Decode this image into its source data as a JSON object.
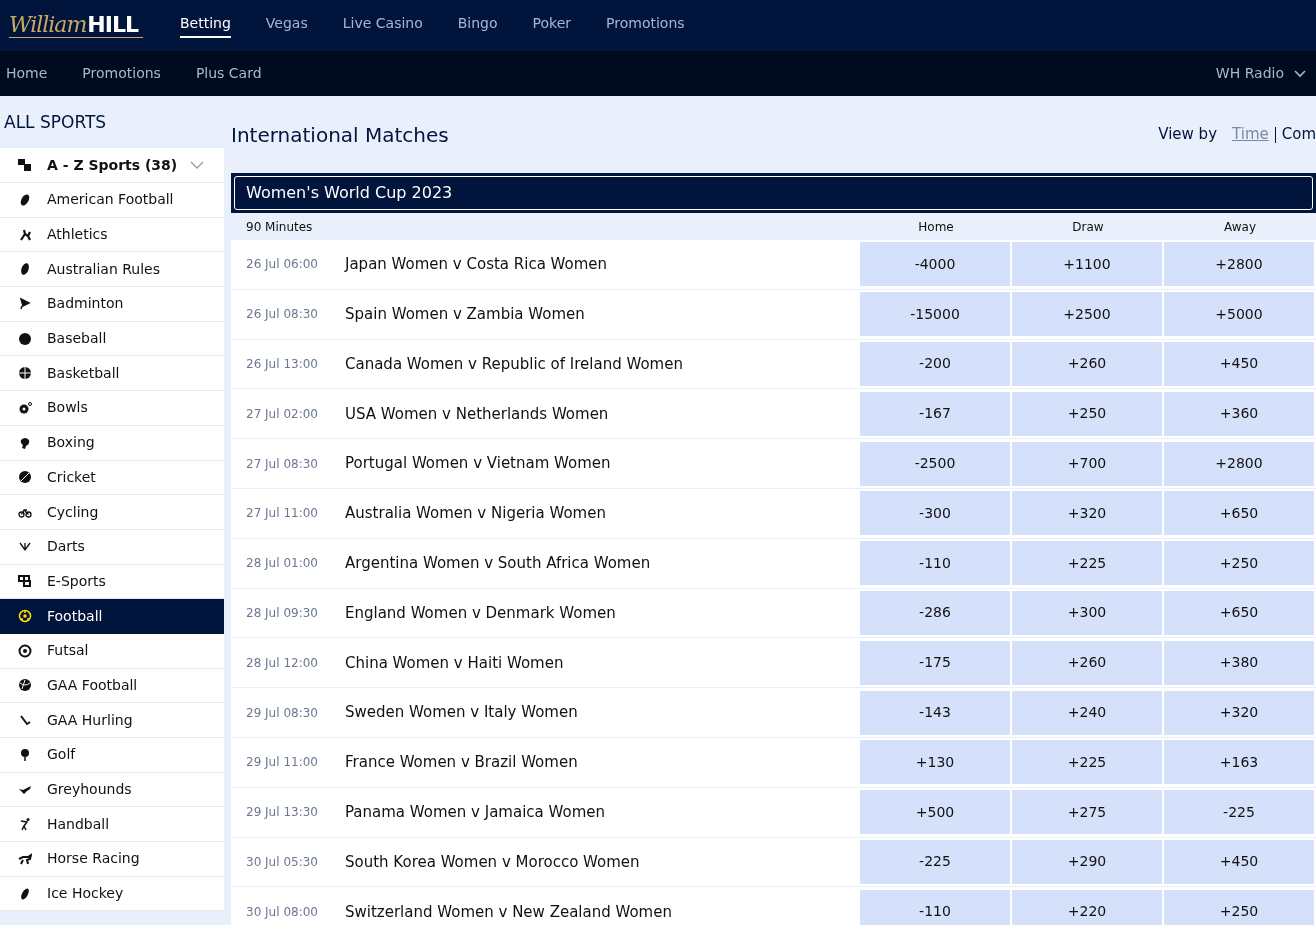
{
  "logo": {
    "script": "William",
    "bold": "HILL"
  },
  "top_nav": [
    {
      "label": "Betting",
      "selected": true
    },
    {
      "label": "Vegas",
      "selected": false
    },
    {
      "label": "Live Casino",
      "selected": false
    },
    {
      "label": "Bingo",
      "selected": false
    },
    {
      "label": "Poker",
      "selected": false
    },
    {
      "label": "Promotions",
      "selected": false
    }
  ],
  "sub_nav": [
    "Home",
    "Promotions",
    "Plus Card"
  ],
  "radio": {
    "label": "WH Radio"
  },
  "sidebar": {
    "title": "ALL SPORTS",
    "az": {
      "label": "A - Z Sports (38)"
    },
    "items": [
      {
        "label": "American Football",
        "selected": false
      },
      {
        "label": "Athletics",
        "selected": false
      },
      {
        "label": "Australian Rules",
        "selected": false
      },
      {
        "label": "Badminton",
        "selected": false
      },
      {
        "label": "Baseball",
        "selected": false
      },
      {
        "label": "Basketball",
        "selected": false
      },
      {
        "label": "Bowls",
        "selected": false
      },
      {
        "label": "Boxing",
        "selected": false
      },
      {
        "label": "Cricket",
        "selected": false
      },
      {
        "label": "Cycling",
        "selected": false
      },
      {
        "label": "Darts",
        "selected": false
      },
      {
        "label": "E-Sports",
        "selected": false
      },
      {
        "label": "Football",
        "selected": true
      },
      {
        "label": "Futsal",
        "selected": false
      },
      {
        "label": "GAA Football",
        "selected": false
      },
      {
        "label": "GAA Hurling",
        "selected": false
      },
      {
        "label": "Golf",
        "selected": false
      },
      {
        "label": "Greyhounds",
        "selected": false
      },
      {
        "label": "Handball",
        "selected": false
      },
      {
        "label": "Horse Racing",
        "selected": false
      },
      {
        "label": "Ice Hockey",
        "selected": false
      }
    ]
  },
  "page_title": "International Matches",
  "view_by": {
    "label": "View by",
    "options": [
      {
        "label": "Time",
        "selected": false
      },
      {
        "label": "Com",
        "selected": true
      }
    ]
  },
  "competition": {
    "title": "Women's World Cup 2023",
    "market": "90 Minutes",
    "columns": [
      "Home",
      "Draw",
      "Away"
    ],
    "matches": [
      {
        "time": "26 Jul 06:00",
        "name": "Japan Women v Costa Rica Women",
        "odds": [
          "-4000",
          "+1100",
          "+2800"
        ]
      },
      {
        "time": "26 Jul 08:30",
        "name": "Spain Women v Zambia Women",
        "odds": [
          "-15000",
          "+2500",
          "+5000"
        ]
      },
      {
        "time": "26 Jul 13:00",
        "name": "Canada Women v Republic of Ireland Women",
        "odds": [
          "-200",
          "+260",
          "+450"
        ]
      },
      {
        "time": "27 Jul 02:00",
        "name": "USA Women v Netherlands Women",
        "odds": [
          "-167",
          "+250",
          "+360"
        ]
      },
      {
        "time": "27 Jul 08:30",
        "name": "Portugal Women v Vietnam Women",
        "odds": [
          "-2500",
          "+700",
          "+2800"
        ]
      },
      {
        "time": "27 Jul 11:00",
        "name": "Australia Women v Nigeria Women",
        "odds": [
          "-300",
          "+320",
          "+650"
        ]
      },
      {
        "time": "28 Jul 01:00",
        "name": "Argentina Women v South Africa Women",
        "odds": [
          "-110",
          "+225",
          "+250"
        ]
      },
      {
        "time": "28 Jul 09:30",
        "name": "England Women v Denmark Women",
        "odds": [
          "-286",
          "+300",
          "+650"
        ]
      },
      {
        "time": "28 Jul 12:00",
        "name": "China Women v Haiti Women",
        "odds": [
          "-175",
          "+260",
          "+380"
        ]
      },
      {
        "time": "29 Jul 08:30",
        "name": "Sweden Women v Italy Women",
        "odds": [
          "-143",
          "+240",
          "+320"
        ]
      },
      {
        "time": "29 Jul 11:00",
        "name": "France Women v Brazil Women",
        "odds": [
          "+130",
          "+225",
          "+163"
        ]
      },
      {
        "time": "29 Jul 13:30",
        "name": "Panama Women v Jamaica Women",
        "odds": [
          "+500",
          "+275",
          "-225"
        ]
      },
      {
        "time": "30 Jul 05:30",
        "name": "South Korea Women v Morocco Women",
        "odds": [
          "-225",
          "+290",
          "+450"
        ]
      },
      {
        "time": "30 Jul 08:00",
        "name": "Switzerland Women v New Zealand Women",
        "odds": [
          "-110",
          "+220",
          "+250"
        ]
      }
    ]
  }
}
